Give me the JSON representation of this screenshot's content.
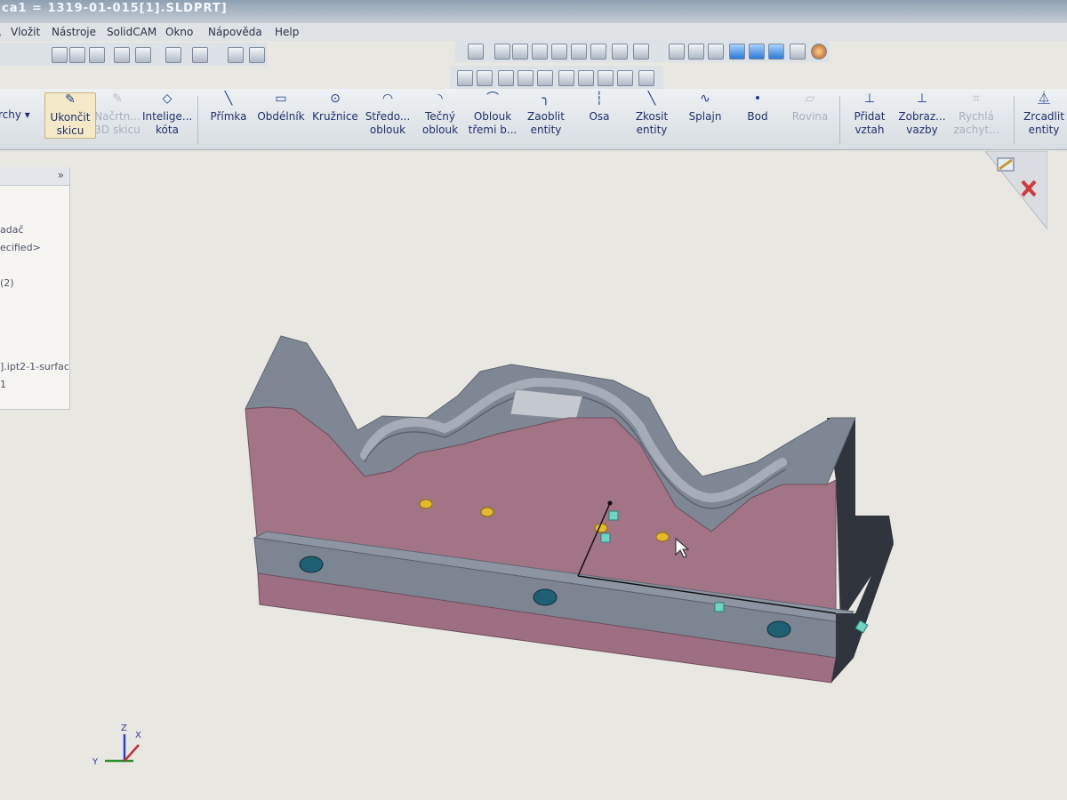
{
  "window": {
    "title": "ca1 = 1319-01-015[1].SLDPRT]"
  },
  "menu": [
    "Vložit",
    "Nástroje",
    "SolidCAM",
    "Okno",
    "Nápověda",
    "Help"
  ],
  "sketch_toolbar": {
    "left_partial": "rchy",
    "exit_sketch": "Ukončit skicu",
    "sketch3d": "Načrtn... 3D skicu",
    "smart_dim": "Intelige... kóta",
    "line": "Přímka",
    "rectangle": "Obdélník",
    "circle": "Kružnice",
    "center_arc": "Středo... oblouk",
    "tangent_arc": "Tečný oblouk",
    "three_point_arc": "Oblouk třemi b...",
    "fillet": "Zaoblit entity",
    "axis": "Osa",
    "chamfer": "Zkosit entity",
    "spline": "Splajn",
    "point": "Bod",
    "plane": "Rovina",
    "add_relation": "Přidat vztah",
    "display_relations": "Zobraz... vazby",
    "quick_snaps": "Rychlá zachyt...",
    "mirror": "Zrcadlit entity"
  },
  "tree_panel": {
    "lines": [
      "adač",
      "ecified>",
      "(2)",
      "].ipt2-1-surfac",
      "1"
    ]
  },
  "triad": {
    "x_label": "X",
    "y_label": "Y",
    "z_label": "Z"
  },
  "colors": {
    "part_face_pink": "#a27486",
    "part_top_gray": "#7f8795",
    "hole_yellow": "#e2bc28",
    "background": "#e9e7e1"
  }
}
